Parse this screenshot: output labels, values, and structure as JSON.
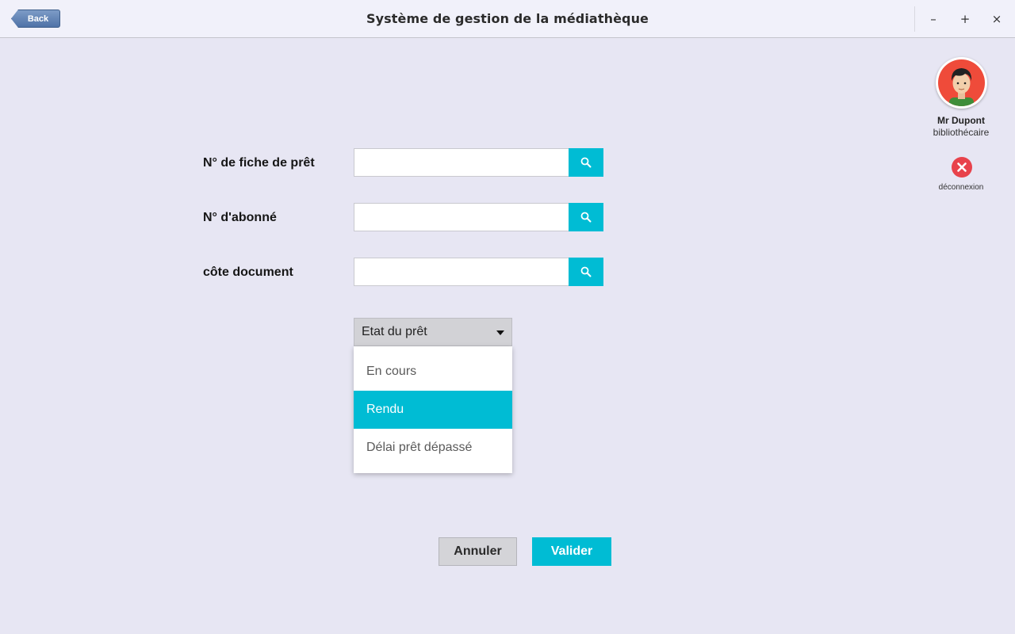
{
  "window": {
    "title": "Système de gestion de la médiathèque",
    "back_label": "Back",
    "minimize_symbol": "–",
    "maximize_symbol": "+",
    "close_symbol": "×"
  },
  "form": {
    "loan_number": {
      "label": "N° de fiche de prêt",
      "value": ""
    },
    "subscriber_number": {
      "label": "N° d'abonné",
      "value": ""
    },
    "document_code": {
      "label": "côte document",
      "value": ""
    },
    "loan_status": {
      "placeholder": "Etat du prêt",
      "options": [
        "En cours",
        "Rendu",
        "Délai prêt dépassé"
      ],
      "highlighted": "Rendu"
    }
  },
  "actions": {
    "cancel_label": "Annuler",
    "validate_label": "Valider"
  },
  "user": {
    "name": "Mr Dupont",
    "role": "bibliothécaire",
    "logout_label": "déconnexion"
  },
  "icons": {
    "search": "magnifier-icon",
    "logout": "close-circle-icon",
    "avatar": "user-avatar-icon"
  },
  "colors": {
    "accent": "#00bcd4",
    "background": "#e7e6f3",
    "titlebar": "#f1f1fa",
    "logout": "#e8424b",
    "back_button": "#5a7cb0"
  }
}
